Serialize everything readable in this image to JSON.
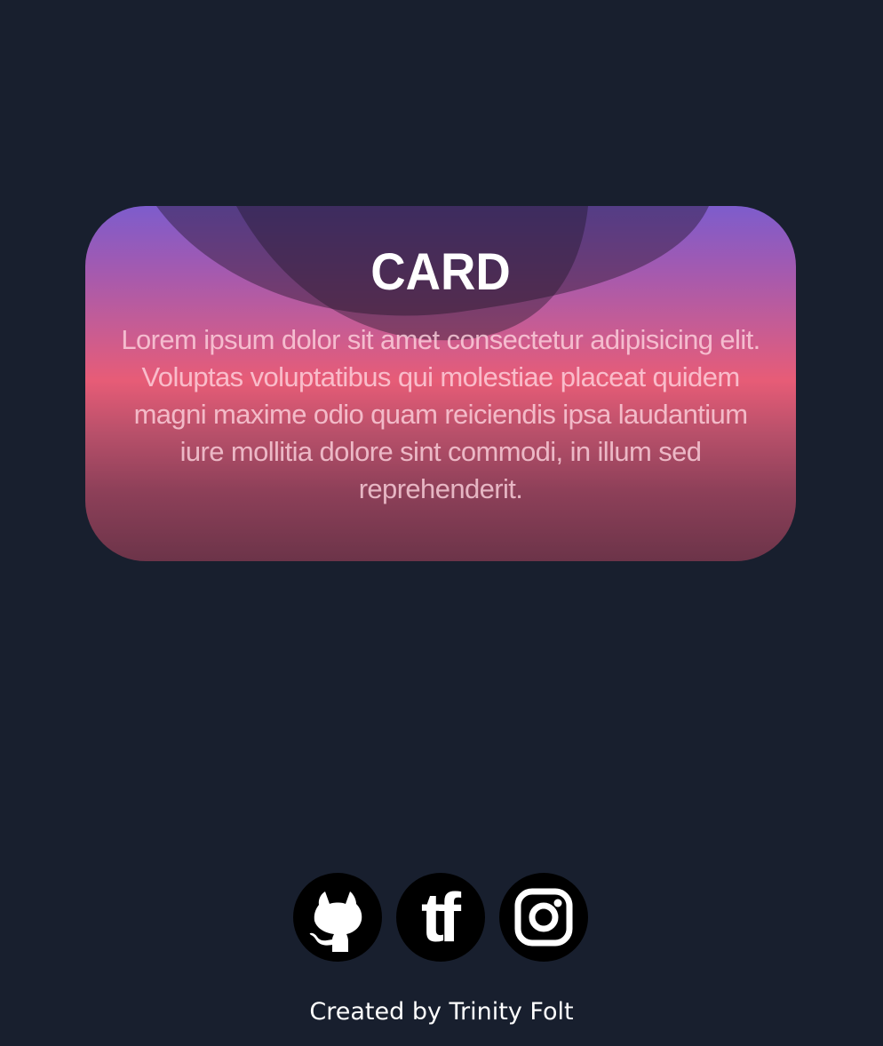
{
  "card": {
    "title": "CARD",
    "text": "Lorem ipsum dolor sit amet consectetur adipisicing elit. Voluptas voluptatibus qui molestiae placeat quidem magni maxime odio quam reiciendis ipsa laudantium iure mollitia dolore sint commodi, in illum sed reprehenderit."
  },
  "socials": [
    {
      "icon": "github-icon"
    },
    {
      "icon": "tf-logo-icon",
      "text": "tf"
    },
    {
      "icon": "instagram-icon"
    }
  ],
  "footer": {
    "credit": "Created by Trinity Folt"
  },
  "colors": {
    "background": "#181f2e",
    "gradient_top": "#7d5ccc",
    "gradient_mid": "#e75c77",
    "gradient_bottom": "#6c3449"
  }
}
